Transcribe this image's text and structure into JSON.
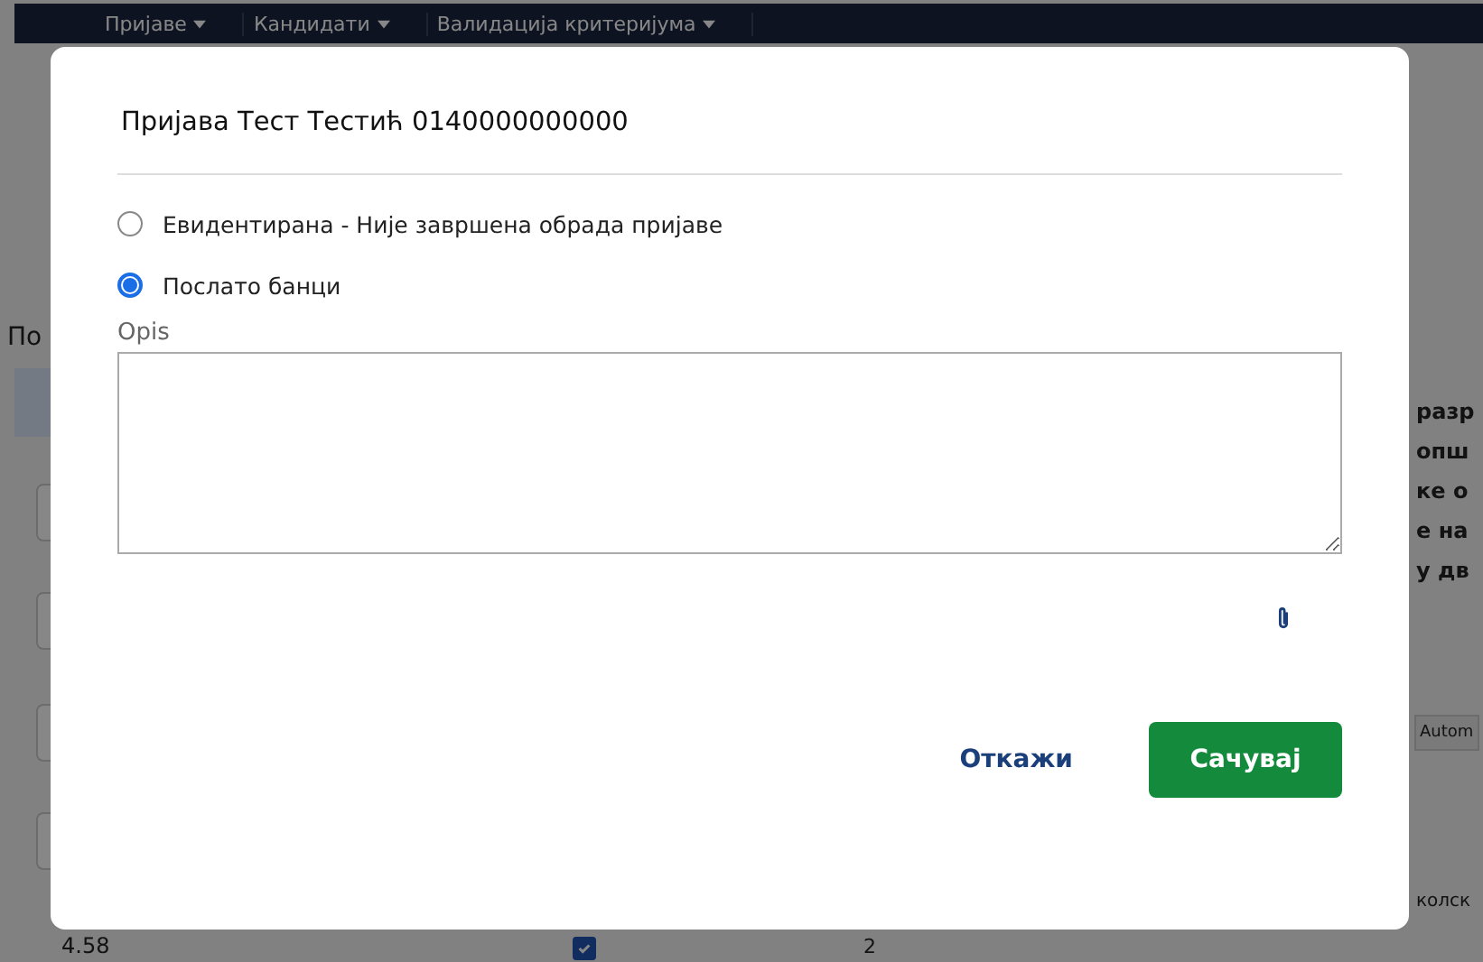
{
  "nav": [
    {
      "label": "Пријаве"
    },
    {
      "label": "Кандидати"
    },
    {
      "label": "Валидација критеријума"
    }
  ],
  "background": {
    "left_heading": "По",
    "right_lines": [
      "разр",
      "опш",
      "ке о",
      "е на",
      "у дв"
    ],
    "tab": "Autom",
    "right_footer": "колск",
    "bottom_value": "4.58",
    "bottom_checked": true,
    "bottom_count": "2"
  },
  "dialog": {
    "title": "Пријава Тест Тестић 0140000000000",
    "options": [
      {
        "label": "Евидентирана - Није завршена обрада пријаве",
        "selected": false
      },
      {
        "label": "Послато банци",
        "selected": true
      }
    ],
    "description": {
      "label": "Opis"
    },
    "buttons": [
      {
        "label": "Откажи",
        "kind": "secondary"
      },
      {
        "label": "Сачувај",
        "kind": "primary"
      }
    ]
  }
}
